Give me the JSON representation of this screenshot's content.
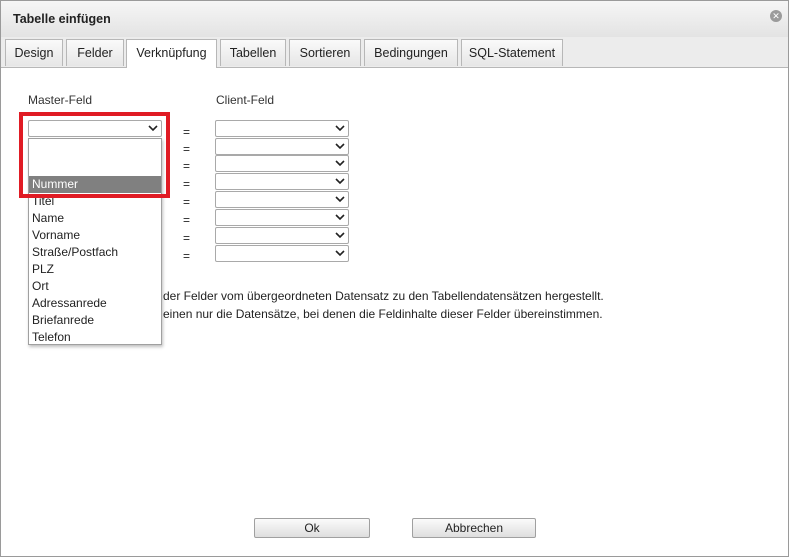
{
  "dialog": {
    "title": "Tabelle einfügen",
    "close_icon": "close-icon"
  },
  "tabs": [
    {
      "label": "Design"
    },
    {
      "label": "Felder"
    },
    {
      "label": "Verknüpfung",
      "active": true
    },
    {
      "label": "Tabellen"
    },
    {
      "label": "Sortieren"
    },
    {
      "label": "Bedingungen"
    },
    {
      "label": "SQL-Statement"
    }
  ],
  "link": {
    "master_header": "Master-Feld",
    "client_header": "Client-Feld",
    "equals": "=",
    "rows": 8,
    "description_line1": "der Felder vom übergeordneten Datensatz zu den Tabellendatensätzen hergestellt.",
    "description_line2": "einen nur die Datensätze, bei denen die Feldinhalte dieser Felder übereinstimmen."
  },
  "master_dropdown": {
    "options": [
      "",
      "Nummer",
      "Titel",
      "Name",
      "Vorname",
      "Straße/Postfach",
      "PLZ",
      "Ort",
      "Adressanrede",
      "Briefanrede",
      "Telefon"
    ],
    "selected": "Nummer"
  },
  "colors": {
    "highlight": "#e01b24",
    "selected_option": "#808080"
  },
  "buttons": {
    "ok": "Ok",
    "cancel": "Abbrechen"
  }
}
